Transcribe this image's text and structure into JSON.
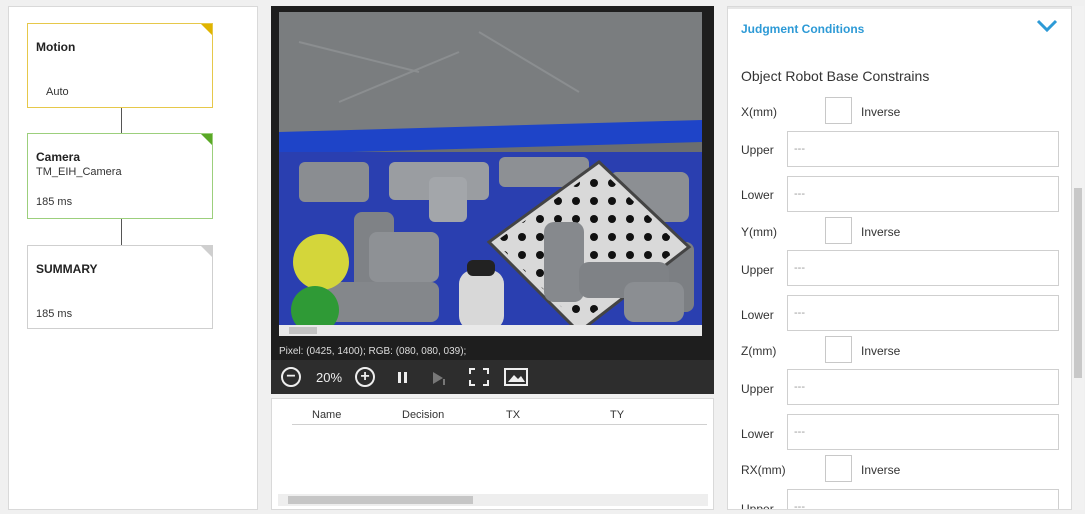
{
  "flow": {
    "motion": {
      "title": "Motion",
      "status": "Auto"
    },
    "camera": {
      "title": "Camera",
      "name": "TM_EIH_Camera",
      "time": "185 ms"
    },
    "summary": {
      "title": "SUMMARY",
      "time": "185 ms"
    }
  },
  "viewer": {
    "pixel_info": "Pixel: (0425, 1400); RGB: (080, 080, 039);",
    "zoom": "20%"
  },
  "results": {
    "columns": [
      "Name",
      "Decision",
      "TX",
      "TY"
    ]
  },
  "judgment": {
    "title": "Judgment Conditions",
    "section": "Object Robot Base Constrains",
    "inverse_label": "Inverse",
    "upper_label": "Upper",
    "lower_label": "Lower",
    "placeholder": "---",
    "axes": [
      {
        "label": "X(mm)"
      },
      {
        "label": "Y(mm)"
      },
      {
        "label": "Z(mm)"
      },
      {
        "label": "RX(mm)"
      }
    ]
  },
  "colors": {
    "accent": "#2d9ad6",
    "motion": "#e0b400",
    "camera": "#5aa826"
  }
}
